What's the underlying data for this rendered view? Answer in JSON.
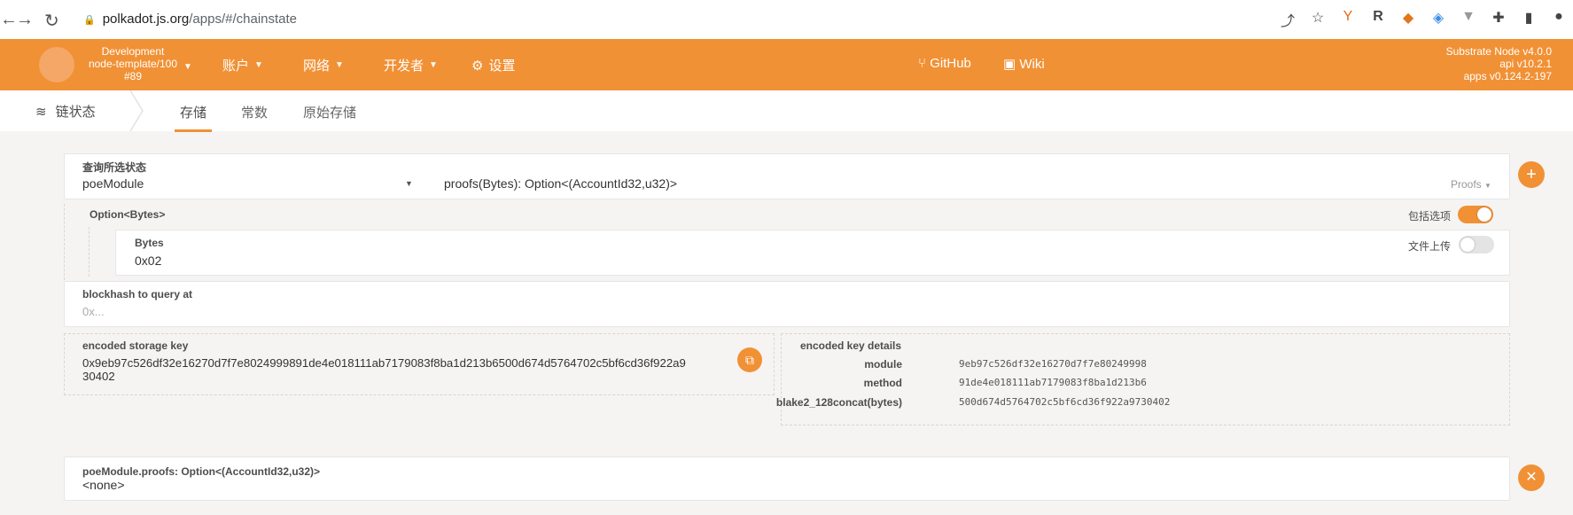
{
  "browser": {
    "url_host": "polkadot.js.org",
    "url_path": "/apps/#/chainstate"
  },
  "header": {
    "chain_name": "Development",
    "node_name": "node-template/100",
    "block": "#89",
    "menus": [
      {
        "label": "账户"
      },
      {
        "label": "网络"
      },
      {
        "label": "开发者"
      },
      {
        "label": "设置"
      }
    ],
    "links": [
      {
        "label": "GitHub"
      },
      {
        "label": "Wiki"
      }
    ],
    "versions": [
      "Substrate Node v4.0.0",
      "api v10.2.1",
      "apps v0.124.2-197"
    ],
    "accent": "#f19135"
  },
  "subnav": {
    "section": "链状态",
    "tabs": [
      {
        "label": "存储",
        "active": true
      },
      {
        "label": "常数",
        "active": false
      },
      {
        "label": "原始存储",
        "active": false
      }
    ]
  },
  "query": {
    "label": "查询所选状态",
    "module": "poeModule",
    "method": "proofs(Bytes): Option<(AccountId32,u32)>",
    "method_doc": "Proofs",
    "option_label": "Option<Bytes>",
    "include_option_label": "包括选项",
    "include_option": true,
    "bytes_label": "Bytes",
    "bytes_value": "0x02",
    "file_upload_label": "文件上传",
    "file_upload": false,
    "blockhash_label": "blockhash to query at",
    "blockhash_placeholder": "0x..."
  },
  "encoded": {
    "key_label": "encoded storage key",
    "key_line1": "0x9eb97c526df32e16270d7f7e8024999891de4e018111ab7179083f8ba1d213b6500d674d5764702c5bf6cd36f922a9",
    "key_line2": "30402",
    "details_label": "encoded key details",
    "details": [
      {
        "k": "module",
        "v": "9eb97c526df32e16270d7f7e80249998"
      },
      {
        "k": "method",
        "v": "91de4e018111ab7179083f8ba1d213b6"
      },
      {
        "k": "blake2_128concat(bytes)",
        "v": "500d674d5764702c5bf6cd36f922a9730402"
      }
    ]
  },
  "result": {
    "title": "poeModule.proofs: Option<(AccountId32,u32)>",
    "value": "<none>"
  }
}
